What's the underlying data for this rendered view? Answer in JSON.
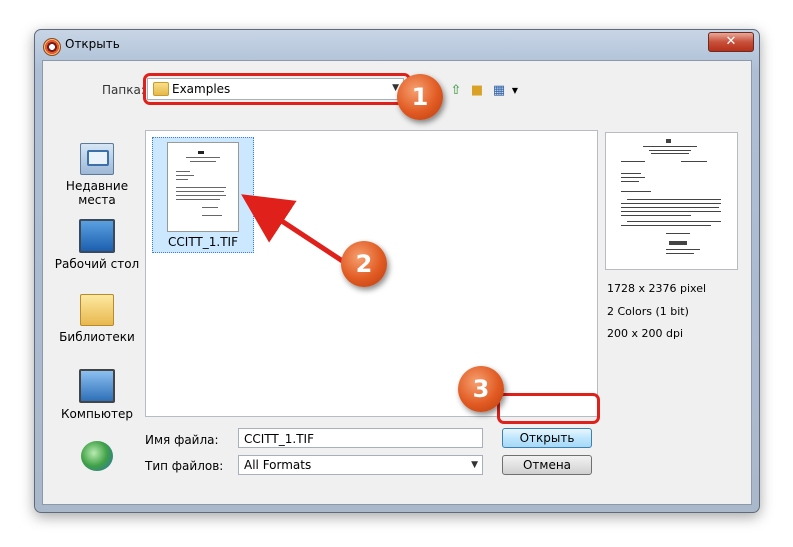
{
  "window": {
    "title": "Открыть",
    "close_label": "✕"
  },
  "toolbar": {
    "look_in_label": "Папка:",
    "look_in_value": "Examples",
    "icons": [
      "up-folder-icon",
      "new-folder-icon",
      "view-menu-icon"
    ]
  },
  "places": [
    {
      "label": "Недавние места",
      "icon": "recent-places-icon"
    },
    {
      "label": "Рабочий стол",
      "icon": "desktop-icon"
    },
    {
      "label": "Библиотеки",
      "icon": "libraries-icon"
    },
    {
      "label": "Компьютер",
      "icon": "computer-icon"
    },
    {
      "label": "",
      "icon": "network-icon"
    }
  ],
  "files": [
    {
      "name": "CCITT_1.TIF",
      "selected": true
    }
  ],
  "preview": {
    "dimensions": "1728 x 2376 pixel",
    "colors": "2 Colors (1 bit)",
    "dpi": "200 x 200 dpi"
  },
  "bottom": {
    "filename_label": "Имя файла:",
    "filename_value": "CCITT_1.TIF",
    "filetype_label": "Тип файлов:",
    "filetype_value": "All Formats",
    "open_button": "Открыть",
    "cancel_button": "Отмена"
  },
  "annotations": {
    "badges": [
      "1",
      "2",
      "3"
    ],
    "highlight_color": "#e0201a",
    "badge_color": "#e15a22"
  }
}
